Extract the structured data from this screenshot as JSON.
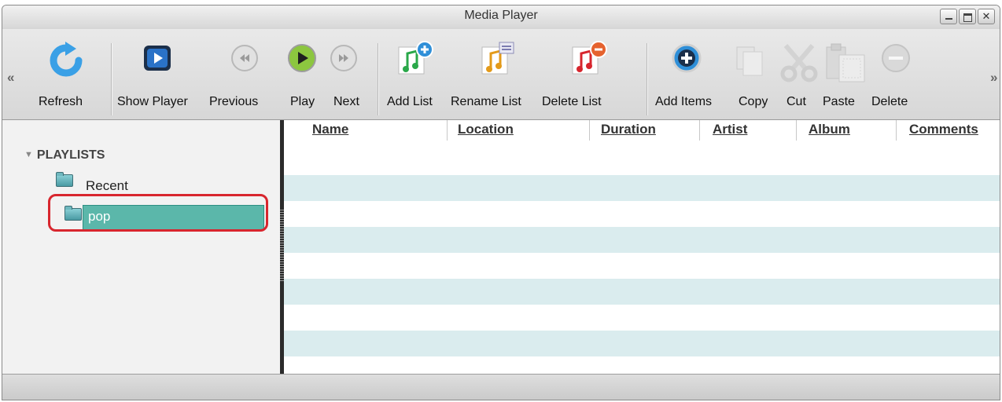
{
  "window": {
    "title": "Media Player"
  },
  "toolbar": {
    "refresh": "Refresh",
    "show_player": "Show Player",
    "previous": "Previous",
    "play": "Play",
    "next": "Next",
    "add_list": "Add List",
    "rename_list": "Rename List",
    "delete_list": "Delete List",
    "add_items": "Add Items",
    "copy": "Copy",
    "cut": "Cut",
    "paste": "Paste",
    "delete": "Delete"
  },
  "sidebar": {
    "section_title": "PLAYLISTS",
    "items": [
      {
        "label": "Recent",
        "selected": false
      },
      {
        "label": "pop",
        "selected": true
      }
    ]
  },
  "table": {
    "columns": [
      "Name",
      "Location",
      "Duration",
      "Artist",
      "Album",
      "Comments"
    ],
    "rows": []
  },
  "colors": {
    "selection": "#5bb7aa",
    "row_alt": "#daecee",
    "highlight_outline": "#d8262e",
    "play_green": "#8cc63f",
    "accent_blue": "#2f8fd8"
  },
  "icons": [
    "refresh-icon",
    "show-player-icon",
    "previous-icon",
    "play-icon",
    "next-icon",
    "add-list-icon",
    "rename-list-icon",
    "delete-list-icon",
    "add-items-icon",
    "copy-icon",
    "cut-icon",
    "paste-icon",
    "delete-icon"
  ]
}
